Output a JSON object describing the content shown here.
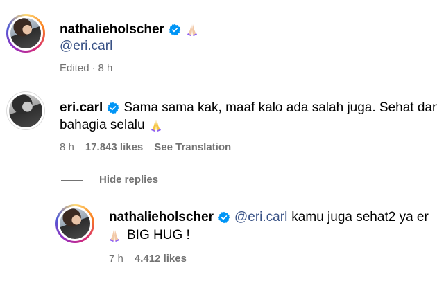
{
  "comments": [
    {
      "username": "nathalieholscher",
      "mention": "@eri.carl",
      "text": "",
      "edited": "Edited",
      "dot": "·",
      "time": "8 h"
    },
    {
      "username": "eri.carl",
      "text_line1": "Sama sama kak, maaf kalo ada salah juga. Sehat dan",
      "text_line2": "bahagia selalu",
      "time": "8 h",
      "likes": "17.843 likes",
      "translate": "See Translation"
    },
    {
      "username": "nathalieholscher",
      "mention": "@eri.carl",
      "text_line1": "kamu juga sehat2 ya er",
      "text_line2": "BIG HUG !",
      "time": "7 h",
      "likes": "4.412 likes"
    }
  ],
  "hide_replies_label": "Hide replies",
  "colors": {
    "verified": "#0095f6",
    "mention": "#385185",
    "meta": "#737373"
  },
  "icons": [
    "verified-badge-icon",
    "praying-hands-emoji-icon"
  ]
}
